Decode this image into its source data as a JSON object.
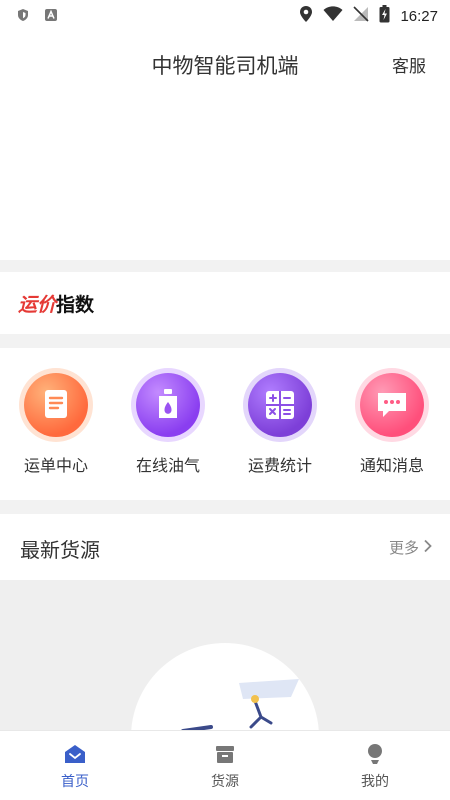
{
  "status_bar": {
    "time": "16:27"
  },
  "header": {
    "title": "中物智能司机端",
    "service_label": "客服"
  },
  "index_section": {
    "title_red": "运价",
    "title_black": "指数"
  },
  "menu": [
    {
      "label": "运单中心",
      "icon": "waybill-icon"
    },
    {
      "label": "在线油气",
      "icon": "fuel-icon"
    },
    {
      "label": "运费统计",
      "icon": "calculator-icon"
    },
    {
      "label": "通知消息",
      "icon": "message-icon"
    }
  ],
  "cargo": {
    "title": "最新货源",
    "more_label": "更多"
  },
  "tabs": [
    {
      "label": "首页",
      "icon": "home-icon",
      "active": true
    },
    {
      "label": "货源",
      "icon": "cargo-box-icon",
      "active": false
    },
    {
      "label": "我的",
      "icon": "profile-icon",
      "active": false
    }
  ],
  "colors": {
    "accent": "#3a5fc9",
    "index_red": "#e53935",
    "icon_orange": "#ff6a3d",
    "icon_purple": "#8a3ef0",
    "icon_violet": "#7d3fd8",
    "icon_pink": "#ff4f7b"
  }
}
